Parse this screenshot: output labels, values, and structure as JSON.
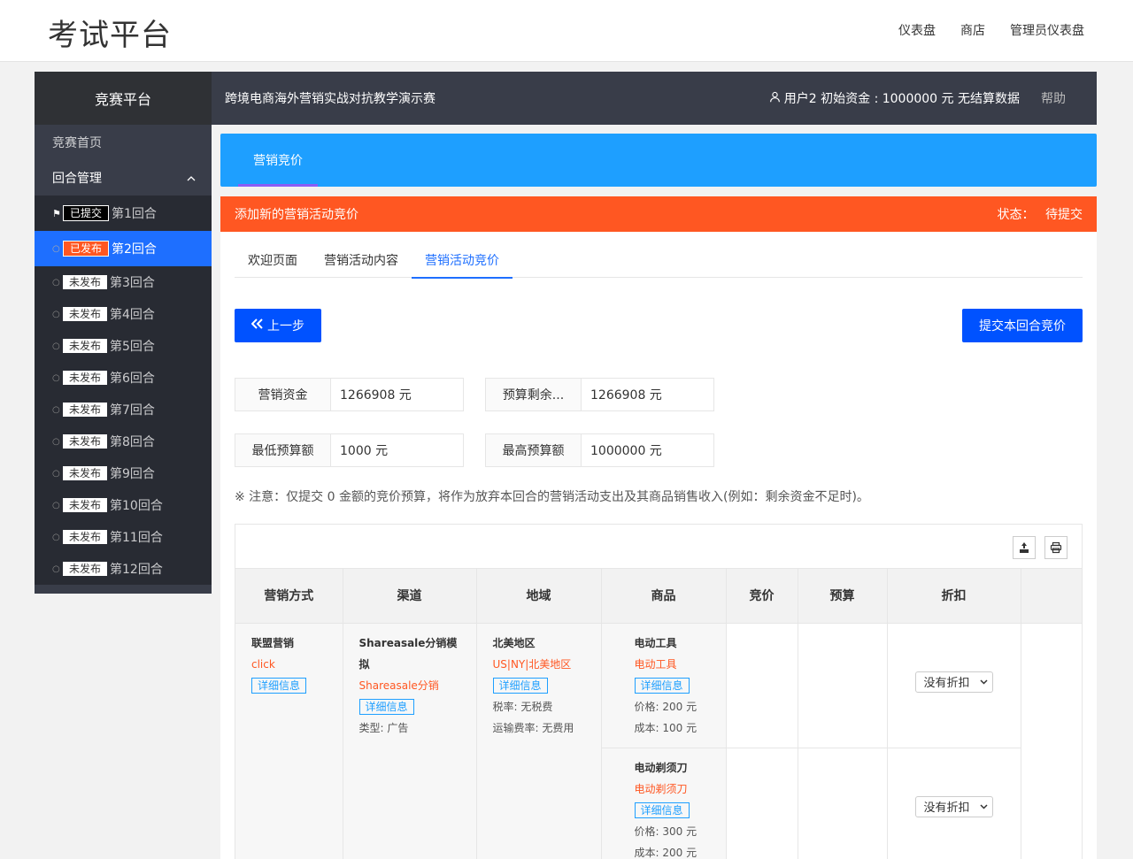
{
  "header": {
    "brand": "考试平台",
    "nav": [
      "仪表盘",
      "商店",
      "管理员仪表盘"
    ]
  },
  "darkbar": {
    "logo": "竞赛平台",
    "contest": "跨境电商海外营销实战对抗教学演示赛",
    "userinfo": "用户2 初始资金 : 1000000 元 无结算数据",
    "help": "帮助"
  },
  "sidebar": {
    "home": "竞赛首页",
    "group": "回合管理",
    "rounds": [
      {
        "badge": "已提交",
        "label": "第1回合"
      },
      {
        "badge": "已发布",
        "label": "第2回合"
      },
      {
        "badge": "未发布",
        "label": "第3回合"
      },
      {
        "badge": "未发布",
        "label": "第4回合"
      },
      {
        "badge": "未发布",
        "label": "第5回合"
      },
      {
        "badge": "未发布",
        "label": "第6回合"
      },
      {
        "badge": "未发布",
        "label": "第7回合"
      },
      {
        "badge": "未发布",
        "label": "第8回合"
      },
      {
        "badge": "未发布",
        "label": "第9回合"
      },
      {
        "badge": "未发布",
        "label": "第10回合"
      },
      {
        "badge": "未发布",
        "label": "第11回合"
      },
      {
        "badge": "未发布",
        "label": "第12回合"
      }
    ]
  },
  "panel": {
    "tab": "营销竞价"
  },
  "card": {
    "title": "添加新的营销活动竞价",
    "status_label": "状态：",
    "status_value": "待提交",
    "tabs": [
      "欢迎页面",
      "营销活动内容",
      "营销活动竞价"
    ],
    "prev_button": "上一步",
    "submit_button": "提交本回合竞价",
    "fields": {
      "funds": {
        "label": "营销资金",
        "value": "1266908 元"
      },
      "remaining": {
        "label": "预算剩余...",
        "value": "1266908 元"
      },
      "min": {
        "label": "最低预算额",
        "value": "1000 元"
      },
      "max": {
        "label": "最高预算额",
        "value": "1000000 元"
      }
    },
    "note": "※ 注意：仅提交 0 金额的竞价预算，将作为放弃本回合的营销活动支出及其商品销售收入(例如：剩余资金不足时)。"
  },
  "table": {
    "headers": [
      "营销方式",
      "渠道",
      "地域",
      "商品",
      "竞价",
      "预算",
      "折扣"
    ],
    "method": {
      "name": "联盟营销",
      "sub": "click",
      "detail": "详细信息"
    },
    "channel": {
      "name": "Shareasale分销模拟",
      "sub": "Shareasale分销",
      "detail": "详细信息",
      "type": "类型: 广告"
    },
    "region": {
      "name": "北美地区",
      "sub": "US|NY|北美地区",
      "detail": "详细信息",
      "tax": "税率: 无税费",
      "shipping": "运输费率: 无费用"
    },
    "products": [
      {
        "name": "电动工具",
        "sub": "电动工具",
        "detail": "详细信息",
        "price": "价格: 200 元",
        "cost": "成本: 100 元",
        "discount": "没有折扣"
      },
      {
        "name": "电动剃须刀",
        "sub": "电动剃须刀",
        "detail": "详细信息",
        "price": "价格: 300 元",
        "cost": "成本: 200 元",
        "discount": "没有折扣"
      }
    ]
  }
}
